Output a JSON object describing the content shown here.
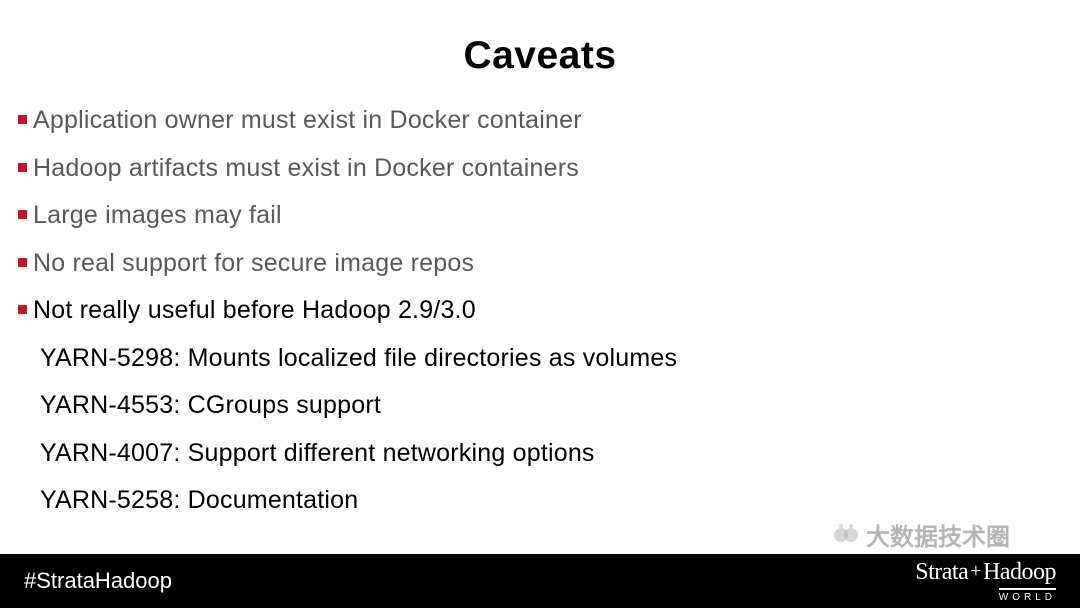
{
  "title": "Caveats",
  "bullets": [
    {
      "text": "Application owner must exist in Docker container",
      "dark": false
    },
    {
      "text": "Hadoop artifacts must exist in Docker containers",
      "dark": false
    },
    {
      "text": "Large images may fail",
      "dark": false
    },
    {
      "text": "No real support for secure image repos",
      "dark": false
    },
    {
      "text": "Not really useful before Hadoop 2.9/3.0",
      "dark": true
    }
  ],
  "subitems": [
    "YARN-5298: Mounts localized file directories as volumes",
    "YARN-4553: CGroups support",
    "YARN-4007: Support different networking options",
    "YARN-5258: Documentation"
  ],
  "footer": {
    "hashtag": "#StrataHadoop",
    "brand_a": "Strata",
    "brand_plus": "+",
    "brand_b": "Hadoop",
    "brand_sub": "WORLD"
  },
  "watermark": "大数据技术圈"
}
